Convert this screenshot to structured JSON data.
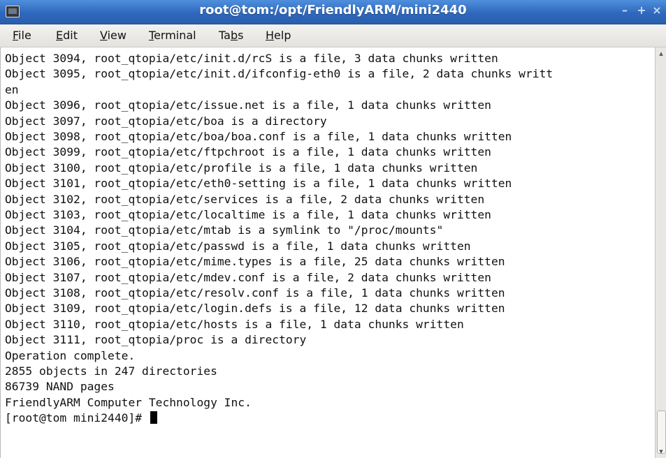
{
  "window": {
    "title": "root@tom:/opt/FriendlyARM/mini2440",
    "icon": "terminal-app-icon",
    "controls": {
      "minimize": "–",
      "maximize": "+",
      "close": "×"
    }
  },
  "menubar": {
    "items": [
      {
        "label_pre": "",
        "mnemonic": "F",
        "label_post": "ile"
      },
      {
        "label_pre": "",
        "mnemonic": "E",
        "label_post": "dit"
      },
      {
        "label_pre": "",
        "mnemonic": "V",
        "label_post": "iew"
      },
      {
        "label_pre": "",
        "mnemonic": "T",
        "label_post": "erminal"
      },
      {
        "label_pre": "Ta",
        "mnemonic": "b",
        "label_post": "s"
      },
      {
        "label_pre": "",
        "mnemonic": "H",
        "label_post": "elp"
      }
    ]
  },
  "terminal": {
    "lines": [
      "Object 3094, root_qtopia/etc/init.d/rcS is a file, 3 data chunks written",
      "Object 3095, root_qtopia/etc/init.d/ifconfig-eth0 is a file, 2 data chunks writt",
      "en",
      "Object 3096, root_qtopia/etc/issue.net is a file, 1 data chunks written",
      "Object 3097, root_qtopia/etc/boa is a directory",
      "Object 3098, root_qtopia/etc/boa/boa.conf is a file, 1 data chunks written",
      "Object 3099, root_qtopia/etc/ftpchroot is a file, 1 data chunks written",
      "Object 3100, root_qtopia/etc/profile is a file, 1 data chunks written",
      "Object 3101, root_qtopia/etc/eth0-setting is a file, 1 data chunks written",
      "Object 3102, root_qtopia/etc/services is a file, 2 data chunks written",
      "Object 3103, root_qtopia/etc/localtime is a file, 1 data chunks written",
      "Object 3104, root_qtopia/etc/mtab is a symlink to \"/proc/mounts\"",
      "Object 3105, root_qtopia/etc/passwd is a file, 1 data chunks written",
      "Object 3106, root_qtopia/etc/mime.types is a file, 25 data chunks written",
      "Object 3107, root_qtopia/etc/mdev.conf is a file, 2 data chunks written",
      "Object 3108, root_qtopia/etc/resolv.conf is a file, 1 data chunks written",
      "Object 3109, root_qtopia/etc/login.defs is a file, 12 data chunks written",
      "Object 3110, root_qtopia/etc/hosts is a file, 1 data chunks written",
      "Object 3111, root_qtopia/proc is a directory",
      "Operation complete.",
      "2855 objects in 247 directories",
      "86739 NAND pages",
      "FriendlyARM Computer Technology Inc."
    ],
    "prompt": "[root@tom mini2440]# "
  }
}
